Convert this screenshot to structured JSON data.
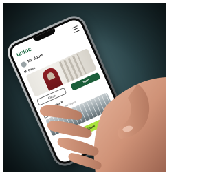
{
  "app": {
    "logo_text": "unloc",
    "section_title": "My doors"
  },
  "door_card": {
    "name": "Mi Casa",
    "close_label": "Close",
    "open_label": "Open"
  },
  "gate_card": {
    "title": "Kongens gate 8",
    "subtitle": "Til nøkkelboksen ved inngang"
  },
  "share_label": "Share",
  "colors": {
    "brand_green": "#1b5e3a",
    "accent_lime": "#a9e23b",
    "door_red": "#8e1e24",
    "background_teal": "#2a4449"
  }
}
